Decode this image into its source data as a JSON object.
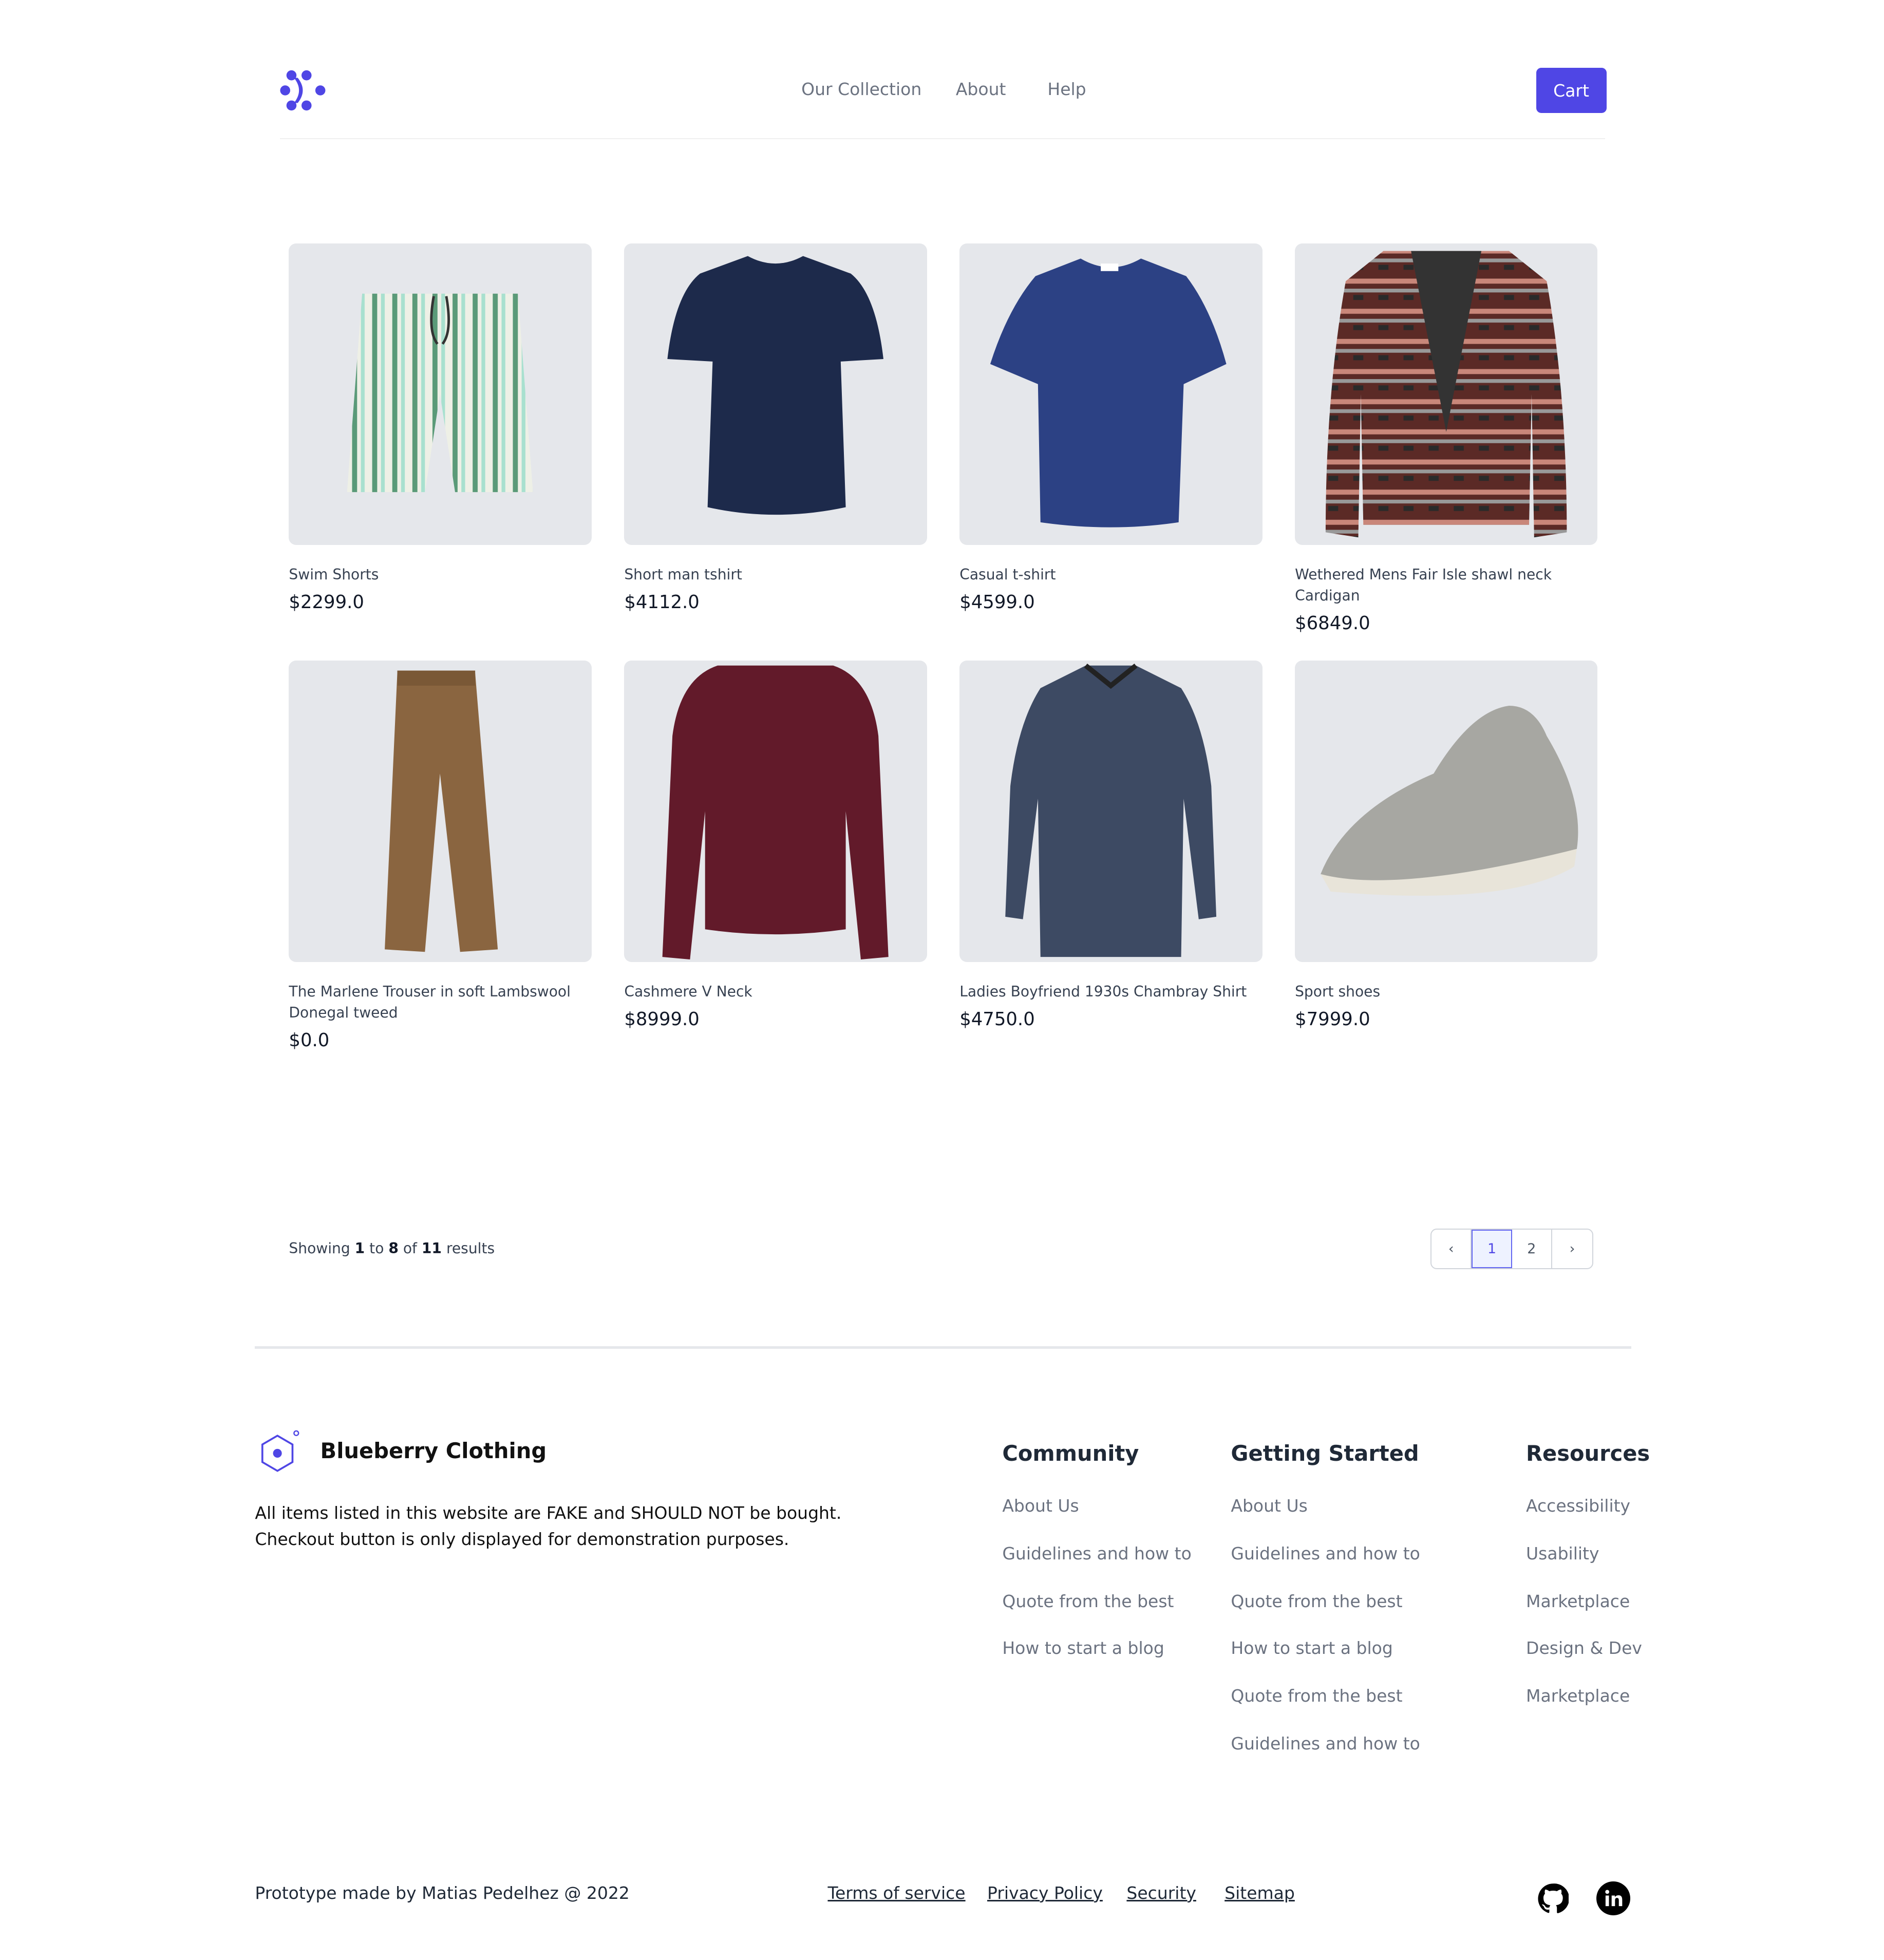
{
  "header": {
    "nav": [
      "Our Collection",
      "About",
      "Help"
    ],
    "cart_label": "Cart",
    "brand_color": "#4f46e5"
  },
  "products": [
    {
      "name": "Swim Shorts",
      "price": "$2299.0"
    },
    {
      "name": "Short man tshirt",
      "price": "$4112.0"
    },
    {
      "name": "Casual t-shirt",
      "price": "$4599.0"
    },
    {
      "name": "Wethered Mens Fair Isle shawl neck Cardigan",
      "price": "$6849.0"
    },
    {
      "name": "The Marlene Trouser in soft Lambswool Donegal tweed",
      "price": "$0.0"
    },
    {
      "name": "Cashmere V Neck",
      "price": "$8999.0"
    },
    {
      "name": "Ladies Boyfriend 1930s Chambray Shirt",
      "price": "$4750.0"
    },
    {
      "name": "Sport shoes",
      "price": "$7999.0"
    }
  ],
  "results": {
    "prefix": "Showing",
    "from": "1",
    "to_word": "to",
    "to": "8",
    "of_word": "of",
    "total": "11",
    "suffix": "results"
  },
  "pagination": {
    "pages": [
      "1",
      "2"
    ],
    "current": "1"
  },
  "footer": {
    "brand": "Blueberry Clothing",
    "description_lines": [
      "All items listed in this website are FAKE and SHOULD NOT be bought.",
      "Checkout button is only displayed for demonstration purposes."
    ],
    "columns": [
      {
        "title": "Community",
        "links": [
          "About Us",
          "Guidelines and how to",
          "Quote from the best",
          "How to start a blog"
        ]
      },
      {
        "title": "Getting Started",
        "links": [
          "About Us",
          "Guidelines and how to",
          "Quote from the best",
          "How to start a blog",
          "Quote from the best",
          "Guidelines and how to"
        ]
      },
      {
        "title": "Resources",
        "links": [
          "Accessibility",
          "Usability",
          "Marketplace",
          "Design & Dev",
          "Marketplace"
        ]
      }
    ],
    "credit": "Prototype made by Matias Pedelhez @ 2022",
    "legal": [
      "Terms of service",
      "Privacy Policy",
      "Security",
      "Sitemap"
    ],
    "social": [
      "github-icon",
      "linkedin-icon"
    ]
  }
}
